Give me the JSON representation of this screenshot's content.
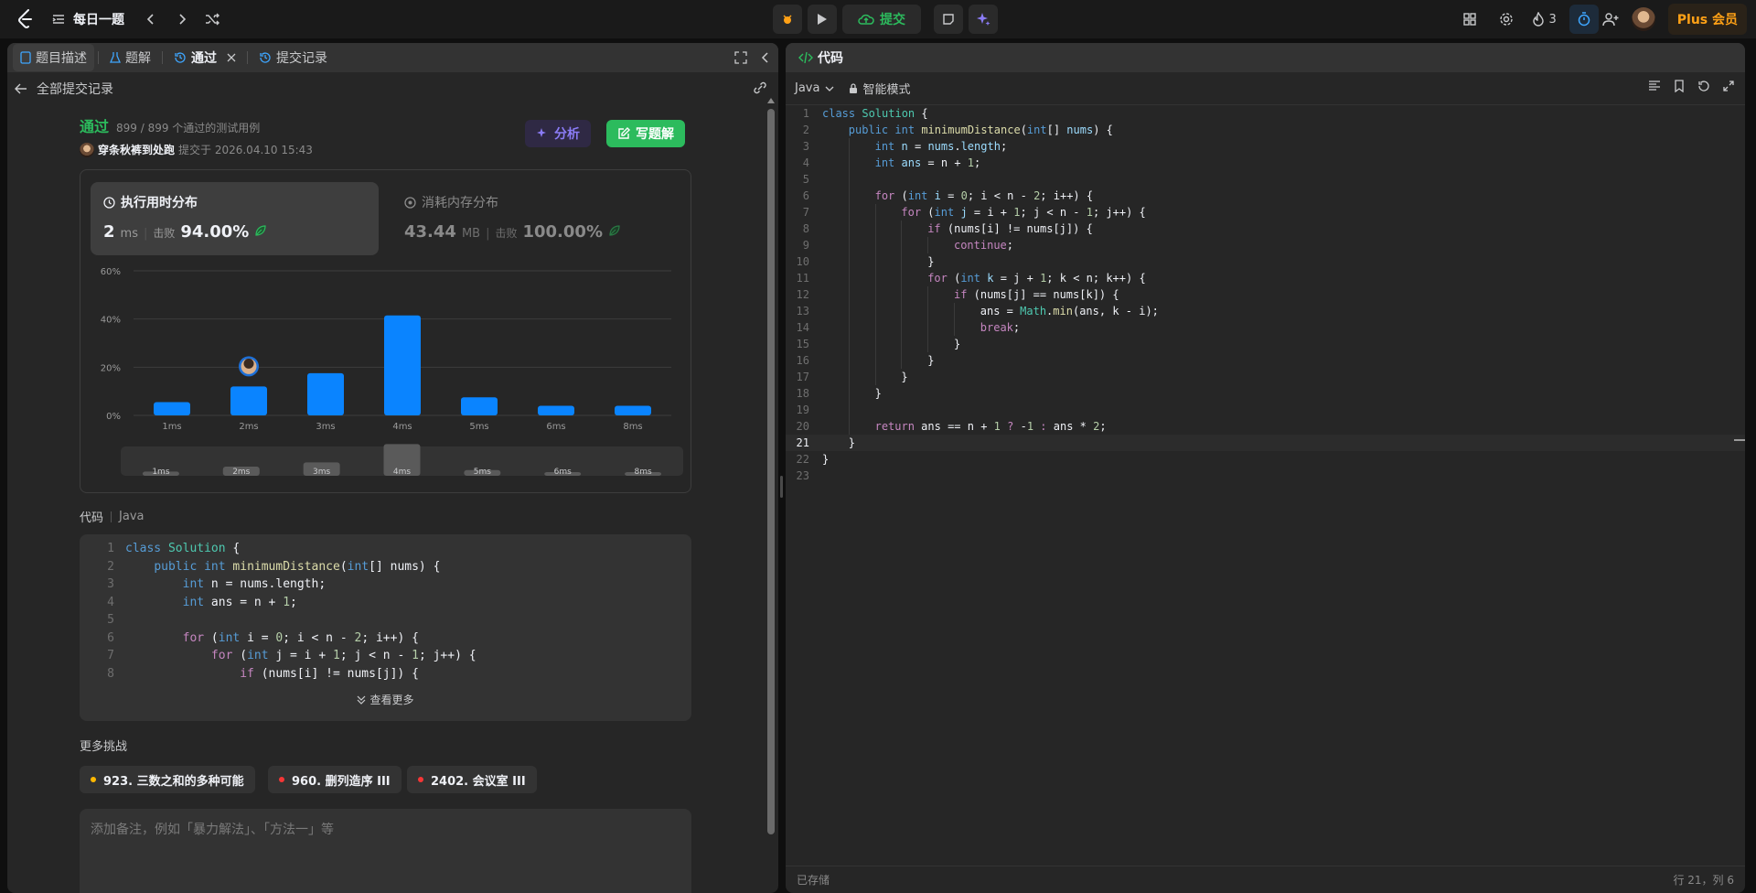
{
  "topbar": {
    "daily_label": "每日一题",
    "submit_label": "提交",
    "streak": "3",
    "plus_label": "Plus 会员"
  },
  "left": {
    "tabs": [
      "题目描述",
      "题解",
      "通过",
      "提交记录"
    ],
    "all_submissions": "全部提交记录",
    "status": "通过",
    "testcases": "899 / 899 个通过的测试用例",
    "user": "穿条秋裤到处跑",
    "submitted_at": "提交于 2026.04.10 15:43",
    "analyze_label": "分析",
    "write_label": "写题解",
    "runtime": {
      "title": "执行用时分布",
      "value": "2",
      "unit": "ms",
      "beat_label": "击败",
      "beat": "94.00%"
    },
    "memory": {
      "title": "消耗内存分布",
      "value": "43.44",
      "unit": "MB",
      "beat_label": "击败",
      "beat": "100.00%"
    },
    "code_label": "代码",
    "code_lang": "Java",
    "see_more": "查看更多",
    "more_challenges": "更多挑战",
    "challenges": [
      {
        "label": "923. 三数之和的多种可能",
        "color": "#ffb800"
      },
      {
        "label": "960. 删列造序 III",
        "color": "#f63636"
      },
      {
        "label": "2402. 会议室 III",
        "color": "#f63636"
      }
    ],
    "note_placeholder": "添加备注，例如「暴力解法」、「方法一」等"
  },
  "chart_data": {
    "type": "bar",
    "categories": [
      "1ms",
      "2ms",
      "3ms",
      "4ms",
      "5ms",
      "6ms",
      "8ms"
    ],
    "values": [
      5.5,
      12,
      17.5,
      41.5,
      7.5,
      4,
      4
    ],
    "ylim": [
      0,
      60
    ],
    "yticks": [
      "60%",
      "40%",
      "20%",
      "0%"
    ],
    "ytick_values": [
      60,
      40,
      20,
      0
    ],
    "highlight": "2ms",
    "bar_color": "#0a84ff",
    "grid": true
  },
  "right": {
    "title": "代码",
    "lang": "Java",
    "mode": "智能模式",
    "saved": "已存储",
    "cursor": "行 21，列 6"
  }
}
